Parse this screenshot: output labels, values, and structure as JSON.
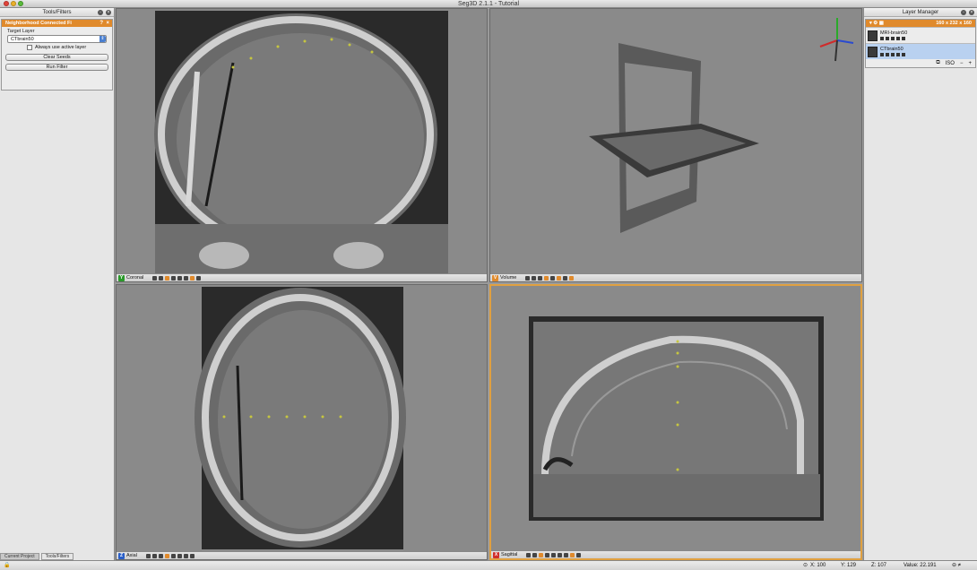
{
  "window": {
    "title": "Seg3D 2.1.1 - Tutorial"
  },
  "tools_panel": {
    "header": "Tools/Filters",
    "filter": {
      "title": "Neighborhood Connected Fi",
      "target_label": "Target Layer",
      "target_value": "CTbrain50",
      "checkbox_label": "Always use active layer",
      "clear_button": "Clear Seeds",
      "run_button": "Run Filter"
    },
    "bottom_tabs": [
      "Current Project",
      "Tools/Filters"
    ]
  },
  "viewers": [
    {
      "badge": "Y",
      "name": "Coronal",
      "badge_color": "#2a9a2a"
    },
    {
      "badge": "V",
      "name": "Volume",
      "badge_color": "#e08a2c"
    },
    {
      "badge": "Z",
      "name": "Axial",
      "badge_color": "#2a5fc8"
    },
    {
      "badge": "X",
      "name": "Sagittal",
      "badge_color": "#d0302a"
    }
  ],
  "layer_manager": {
    "header": "Layer Manager",
    "group_dims": "160 x 232 x 160",
    "layers": [
      {
        "name": "MRI-brain50",
        "selected": false
      },
      {
        "name": "CTbrain50",
        "selected": true
      }
    ],
    "iso_label": "ISO"
  },
  "status": {
    "x": "X: 100",
    "y": "Y: 129",
    "z": "Z: 107",
    "value": "Value: 22.191"
  }
}
